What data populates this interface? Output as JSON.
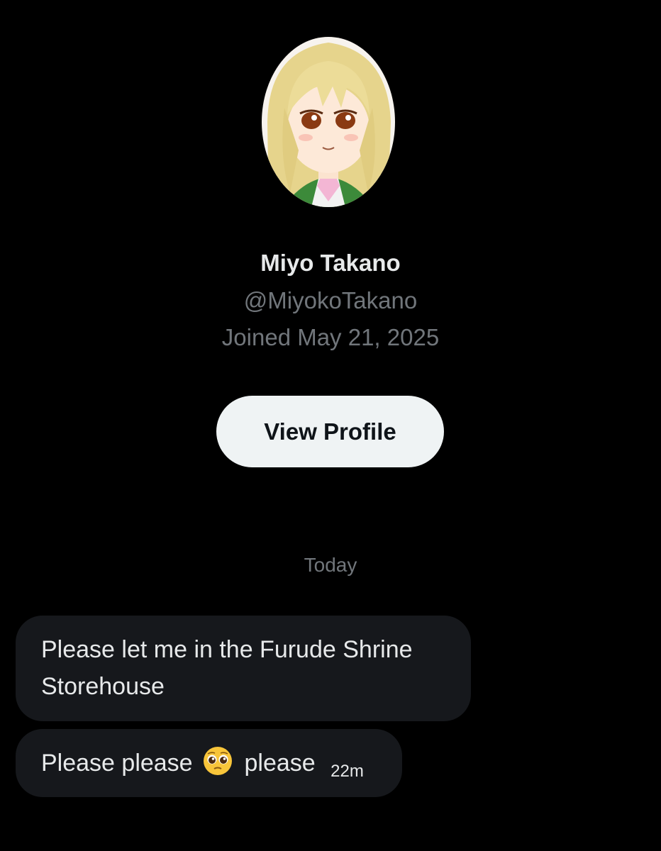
{
  "profile": {
    "avatar_icon": "anime-girl-avatar",
    "display_name": "Miyo Takano",
    "handle": "@MiyokoTakano",
    "joined": "Joined May 21, 2025",
    "view_profile_label": "View Profile"
  },
  "conversation": {
    "date_separator": "Today",
    "messages": [
      {
        "text": "Please let me in the Furude Shrine Storehouse"
      },
      {
        "text_before": "Please please",
        "emoji": "pleading-face",
        "text_after": "please",
        "timestamp": "22m"
      }
    ]
  },
  "colors": {
    "background": "#000000",
    "primary_text": "#e7e9ea",
    "secondary_text": "#71767b",
    "button_bg": "#eff3f4",
    "bubble_bg": "#16181c"
  }
}
